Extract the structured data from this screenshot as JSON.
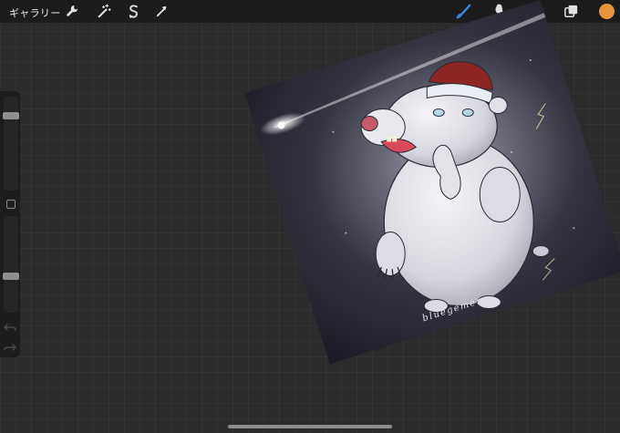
{
  "header": {
    "gallery_label": "ギャラリー"
  },
  "toolbar": {
    "left_tools": [
      "wrench-icon",
      "magic-wand-icon",
      "selection-icon",
      "transform-icon"
    ],
    "right_tools": [
      "brush-icon",
      "smudge-icon",
      "eraser-icon",
      "layers-icon"
    ],
    "active_tool": "brush-icon",
    "active_color": "#e8943a",
    "accent": "#3e86f0"
  },
  "sidebar": {
    "brush_size": 0.87,
    "opacity": 0.38
  },
  "canvas": {
    "signature": "bluegemer"
  }
}
